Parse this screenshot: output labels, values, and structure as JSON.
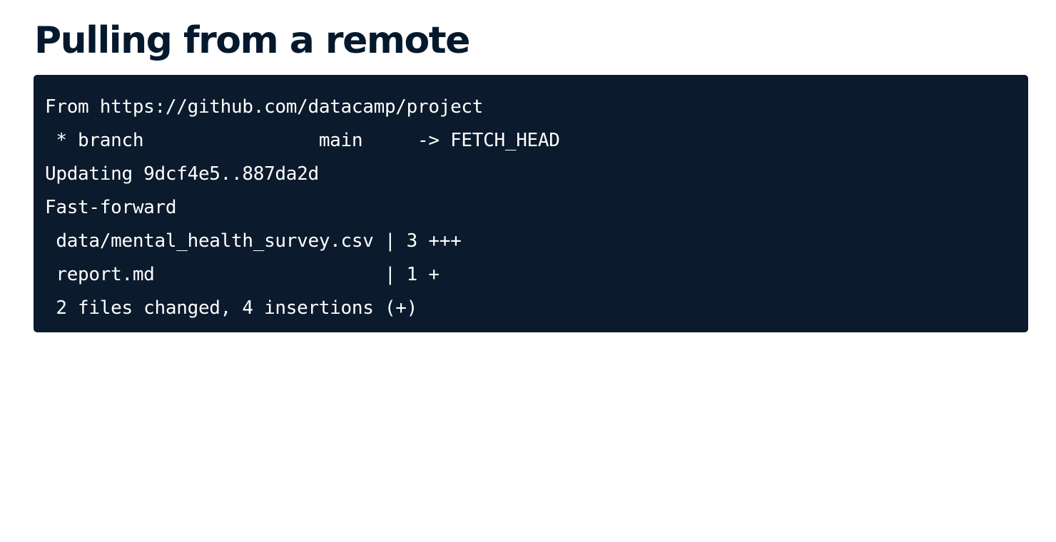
{
  "title": "Pulling from a remote",
  "terminal": {
    "lines": [
      "From https://github.com/datacamp/project",
      " * branch                main     -> FETCH_HEAD",
      "Updating 9dcf4e5..887da2d",
      "Fast-forward",
      " data/mental_health_survey.csv | 3 +++",
      " report.md                     | 1 +",
      " 2 files changed, 4 insertions (+)"
    ]
  },
  "colors": {
    "title_text": "#05192d",
    "terminal_background": "#0b1a2c",
    "terminal_text": "#ffffff",
    "page_background": "#ffffff"
  }
}
